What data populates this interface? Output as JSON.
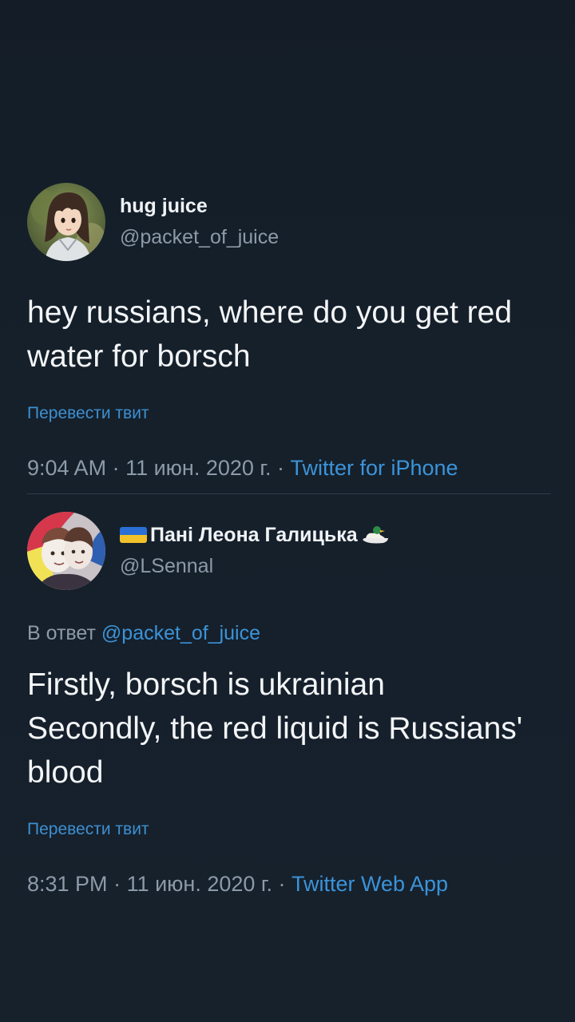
{
  "tweets": [
    {
      "display_name": "hug juice",
      "handle": "@packet_of_juice",
      "avatar_icon": "anime-girl-avatar",
      "text": "hey russians, where do you get red water for borsch",
      "translate_label": "Перевести твит",
      "time": "9:04 AM",
      "date": "11 июн. 2020 г.",
      "source": "Twitter for iPhone",
      "separator": " · "
    },
    {
      "display_name": "Пані Леона Галицька",
      "handle": "@LSennal",
      "avatar_icon": "anime-character-avatar",
      "flag_icon": "ukraine-flag-icon",
      "trailing_icon": "duck-icon",
      "reply_prefix": "В ответ ",
      "reply_mention": "@packet_of_juice",
      "text": "Firstly, borsch is ukrainian\nSecondly, the red liquid is Russians' blood",
      "translate_label": "Перевести твит",
      "time": "8:31 PM",
      "date": "11 июн. 2020 г.",
      "source": "Twitter Web App",
      "separator": " · "
    }
  ],
  "colors": {
    "background": "#15202b",
    "link": "#3c93d8",
    "muted": "#8d9aa7",
    "text": "#f3f5f7"
  }
}
